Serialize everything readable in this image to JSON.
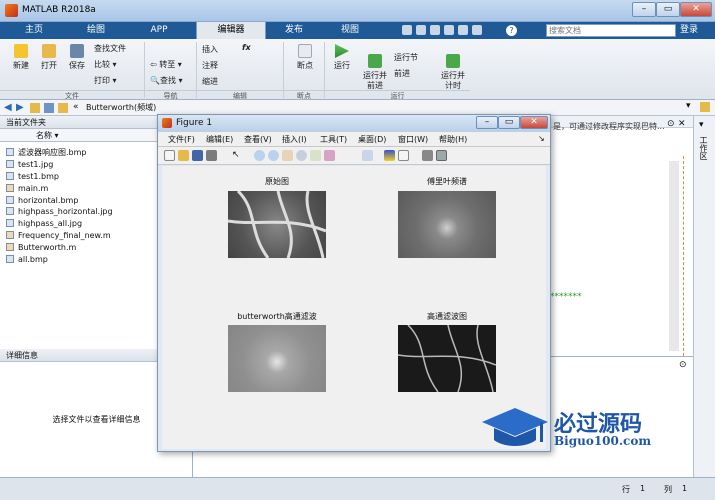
{
  "window": {
    "title": "MATLAB R2018a"
  },
  "tabs": [
    {
      "label": "主页"
    },
    {
      "label": "绘图"
    },
    {
      "label": "APP"
    },
    {
      "label": "编辑器"
    },
    {
      "label": "发布"
    },
    {
      "label": "视图"
    }
  ],
  "search": {
    "placeholder": "搜索文档",
    "login": "登录"
  },
  "ribbon": {
    "file": {
      "new": "新建",
      "open": "打开",
      "save": "保存",
      "find_files": "查找文件",
      "compare": "比较",
      "print": "打印",
      "section": "文件"
    },
    "nav": {
      "goto": "转至",
      "find": "查找",
      "section": "导航"
    },
    "edit": {
      "insert": "插入",
      "comment": "注释",
      "indent": "缩进",
      "fx": "fx",
      "section": "编辑"
    },
    "breakpoints": {
      "label": "断点",
      "section": "断点"
    },
    "run": {
      "run": "运行",
      "run_advance": "运行并\n前进",
      "run_section": "运行节",
      "advance": "前进",
      "run_time": "运行并\n计时",
      "section": "运行"
    }
  },
  "address": {
    "path": "Butterworth(频域)",
    "chevron": "«"
  },
  "left": {
    "title": "当前文件夹",
    "col_name": "名称",
    "files": [
      "滤波器响应图.bmp",
      "test1.jpg",
      "test1.bmp",
      "main.m",
      "horizontal.bmp",
      "highpass_horizontal.jpg",
      "highpass_all.jpg",
      "Frequency_final_new.m",
      "Butterworth.m",
      "all.bmp"
    ],
    "detail_title": "详细信息",
    "detail_msg": "选择文件以查看详细信息"
  },
  "editor": {
    "hint": "是，可通过修改程序实现巴特...",
    "stars": "*******"
  },
  "side": {
    "workspace": "工作区"
  },
  "figure": {
    "title": "Figure 1",
    "menu": [
      "文件(F)",
      "编辑(E)",
      "查看(V)",
      "插入(I)",
      "工具(T)",
      "桌面(D)",
      "窗口(W)",
      "帮助(H)"
    ],
    "plots": [
      {
        "title": "原始图"
      },
      {
        "title": "傅里叶频谱"
      },
      {
        "title": "butterworth高通滤波"
      },
      {
        "title": "高通滤波图"
      }
    ]
  },
  "status": {
    "row_label": "行",
    "row": "1",
    "col_label": "列",
    "col": "1"
  },
  "watermark": {
    "brand": "必过源码",
    "url": "Biguo100.com"
  }
}
